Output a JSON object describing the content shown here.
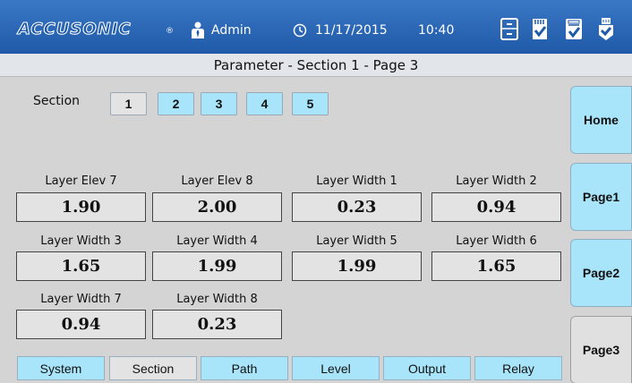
{
  "header": {
    "logo": "ACCUSONIC",
    "logo_mark": "®",
    "user": "Admin",
    "date": "11/17/2015",
    "time": "10:40",
    "status_icons": [
      "storage-icon",
      "sd-card-check-icon",
      "storage-check-icon",
      "usb-check-icon"
    ]
  },
  "title": "Parameter - Section 1 - Page 3",
  "section_selector": {
    "label": "Section",
    "buttons": [
      "1",
      "2",
      "3",
      "4",
      "5"
    ],
    "active": "1"
  },
  "params": [
    {
      "label": "Layer Elev 7",
      "value": "1.90"
    },
    {
      "label": "Layer Elev 8",
      "value": "2.00"
    },
    {
      "label": "Layer Width 1",
      "value": "0.23"
    },
    {
      "label": "Layer Width 2",
      "value": "0.94"
    },
    {
      "label": "Layer Width 3",
      "value": "1.65"
    },
    {
      "label": "Layer Width 4",
      "value": "1.99"
    },
    {
      "label": "Layer Width 5",
      "value": "1.99"
    },
    {
      "label": "Layer Width 6",
      "value": "1.65"
    },
    {
      "label": "Layer Width 7",
      "value": "0.94"
    },
    {
      "label": "Layer Width 8",
      "value": "0.23"
    }
  ],
  "nav": [
    "Home",
    "Page1",
    "Page2",
    "Page3"
  ],
  "nav_active": "Page3",
  "tabs": [
    "System",
    "Section",
    "Path",
    "Level",
    "Output",
    "Relay"
  ],
  "tab_active": "Section",
  "colors": {
    "header_blue": "#1f5aa8",
    "button_cyan": "#a9e5fa",
    "active_gray": "#e3e3e3",
    "background": "#d4d4d4"
  }
}
